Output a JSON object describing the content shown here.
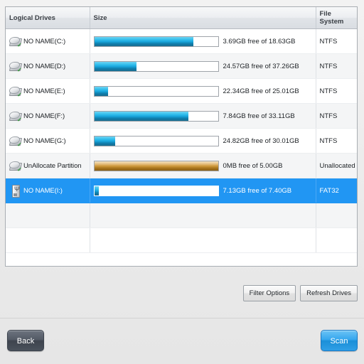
{
  "colors": {
    "selection": "#2196f3",
    "bar_fill": "#19a7dd",
    "bar_fill_unallocated": "#cf9a3d",
    "panel_bg": "#ffffff",
    "window_bg": "#ececec",
    "scan_accent": "#35a7ee"
  },
  "table": {
    "headers": {
      "name": "Logical Drives",
      "size": "Size",
      "filesystem": "File System"
    },
    "rows": [
      {
        "icon": "hard-disk-icon",
        "label": "NO NAME(C:)",
        "free": "3.69GB",
        "total": "18.63GB",
        "size_text": "3.69GB free of 18.63GB",
        "used_percent": 80,
        "filesystem": "NTFS",
        "selected": false,
        "bar_color": "blue"
      },
      {
        "icon": "hard-disk-icon",
        "label": "NO NAME(D:)",
        "free": "24.57GB",
        "total": "37.26GB",
        "size_text": "24.57GB free of 37.26GB",
        "used_percent": 34,
        "filesystem": "NTFS",
        "selected": false,
        "bar_color": "blue"
      },
      {
        "icon": "hard-disk-icon",
        "label": "NO NAME(E:)",
        "free": "22.34GB",
        "total": "25.01GB",
        "size_text": "22.34GB free of 25.01GB",
        "used_percent": 11,
        "filesystem": "NTFS",
        "selected": false,
        "bar_color": "blue"
      },
      {
        "icon": "hard-disk-icon",
        "label": "NO NAME(F:)",
        "free": "7.84GB",
        "total": "33.11GB",
        "size_text": "7.84GB free of 33.11GB",
        "used_percent": 76,
        "filesystem": "NTFS",
        "selected": false,
        "bar_color": "blue"
      },
      {
        "icon": "hard-disk-icon",
        "label": "NO NAME(G:)",
        "free": "24.82GB",
        "total": "30.01GB",
        "size_text": "24.82GB free of 30.01GB",
        "used_percent": 17,
        "filesystem": "NTFS",
        "selected": false,
        "bar_color": "blue"
      },
      {
        "icon": "hard-disk-icon",
        "label": "UnAllocate Partition",
        "free": "0MB",
        "total": "5.00GB",
        "size_text": "0MB free of 5.00GB",
        "used_percent": 100,
        "filesystem": "Unallocated",
        "selected": false,
        "bar_color": "orange"
      },
      {
        "icon": "usb-drive-icon",
        "label": "NO NAME(I:)",
        "free": "7.13GB",
        "total": "7.40GB",
        "size_text": "7.13GB free of 7.40GB",
        "used_percent": 4,
        "filesystem": "FAT32",
        "selected": true,
        "bar_color": "blue"
      }
    ],
    "empty_rows": 2
  },
  "mid_buttons": {
    "filter_options": "Filter Options",
    "refresh_drives": "Refresh Drives"
  },
  "footer": {
    "back": "Back",
    "scan": "Scan"
  }
}
